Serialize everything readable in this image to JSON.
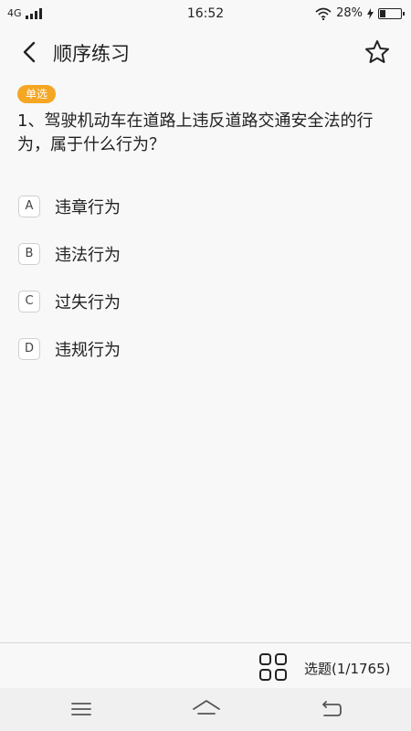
{
  "status_bar": {
    "network": "4G",
    "time": "16:52",
    "battery_text": "28%",
    "battery_level": 0.28
  },
  "header": {
    "title": "顺序练习"
  },
  "question": {
    "type_badge": "单选",
    "text": "1、驾驶机动车在道路上违反道路交通安全法的行为，属于什么行为？",
    "options": [
      {
        "letter": "A",
        "text": "违章行为"
      },
      {
        "letter": "B",
        "text": "违法行为"
      },
      {
        "letter": "C",
        "text": "过失行为"
      },
      {
        "letter": "D",
        "text": "违规行为"
      }
    ]
  },
  "bottom_bar": {
    "progress_label": "选题(1/1765)"
  },
  "colors": {
    "badge": "#f5a623",
    "background": "#f8f8f8",
    "text": "#222222"
  },
  "icons": {
    "back": "chevron-left-icon",
    "favorite": "star-outline-icon",
    "question-grid": "grid-icon",
    "nav_menu": "menu-icon",
    "nav_home": "home-icon",
    "nav_back": "back-arrow-icon"
  }
}
